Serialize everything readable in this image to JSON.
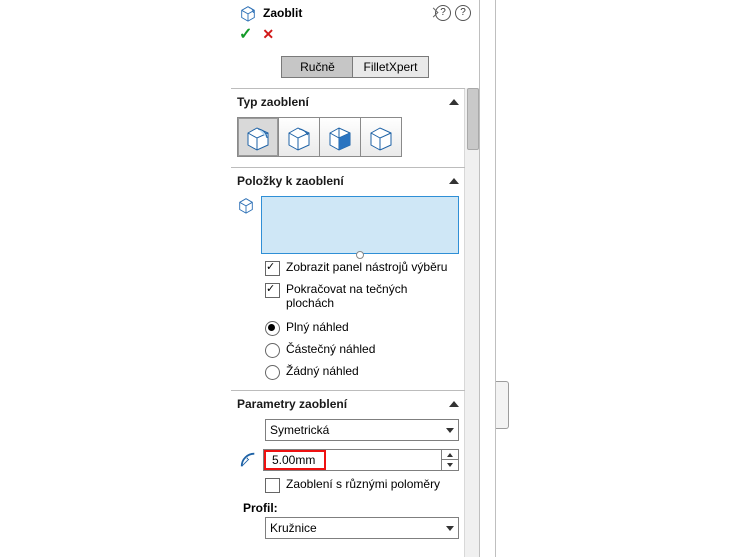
{
  "header": {
    "title": "Zaoblit"
  },
  "tabs": {
    "manual": "Ručně",
    "xpert": "FilletXpert"
  },
  "sections": {
    "type": {
      "title": "Typ zaoblení"
    },
    "items": {
      "title": "Položky k zaoblení"
    },
    "params": {
      "title": "Parametry zaoblení"
    }
  },
  "items": {
    "show_toolbar": "Zobrazit panel nástrojů výběru",
    "tangent": "Pokračovat na tečných plochách",
    "preview_full": "Plný náhled",
    "preview_part": "Částečný náhled",
    "preview_none": "Žádný náhled"
  },
  "params": {
    "symmetric": "Symetrická",
    "radius_value": "5.00mm",
    "multi_radius": "Zaoblení s různými poloměry",
    "profile_label": "Profil:",
    "profile_value": "Kružnice"
  },
  "icons": {
    "header_cube": "fillet-feature-icon"
  }
}
